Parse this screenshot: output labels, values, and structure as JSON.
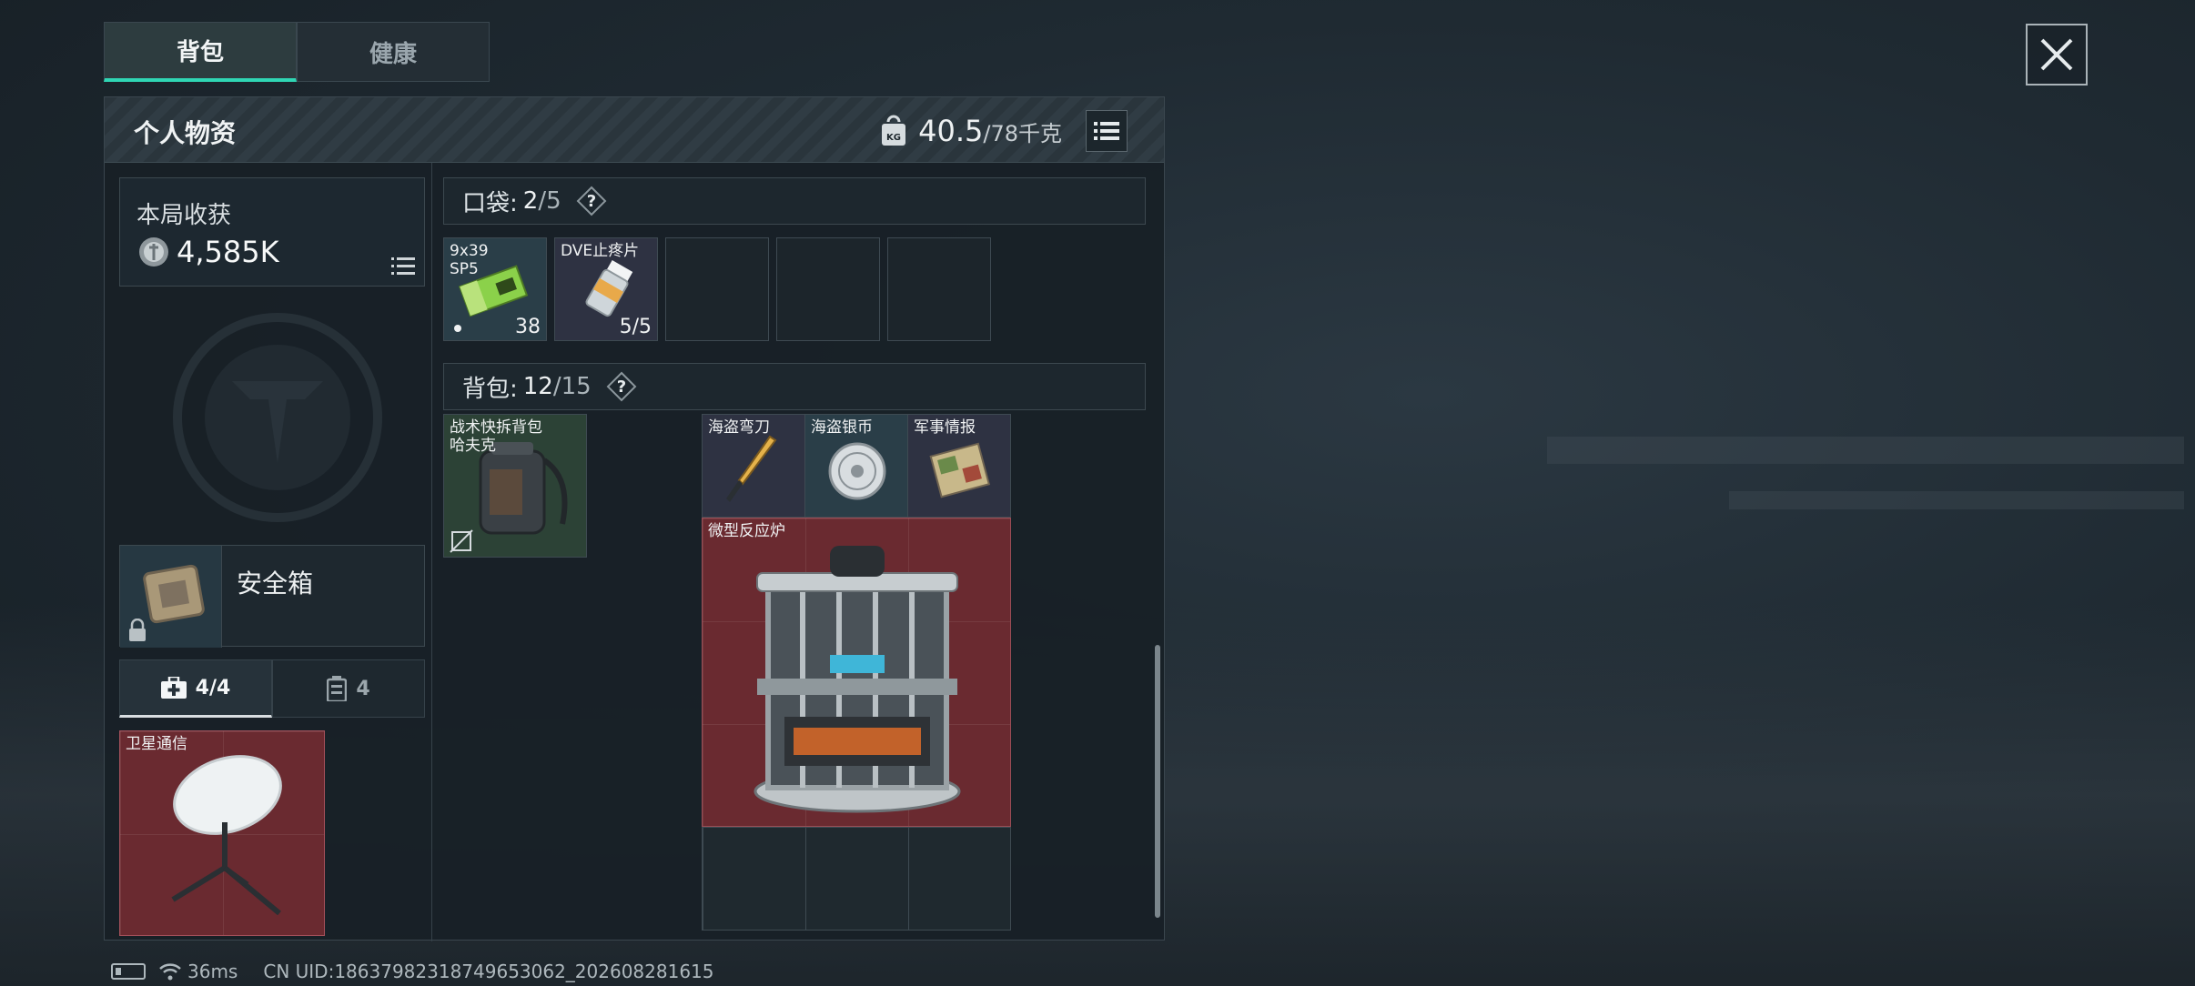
{
  "tabs": [
    {
      "label": "背包",
      "active": true
    },
    {
      "label": "健康",
      "active": false
    }
  ],
  "panel": {
    "title": "个人物资",
    "weight_current": "40.5",
    "weight_max": "/78千克",
    "weight_icon_text": "KG"
  },
  "haul": {
    "label": "本局收获",
    "value": "4,585K"
  },
  "safebox": {
    "label": "安全箱"
  },
  "sub_tabs": [
    {
      "label": "4/4",
      "icon": "medkit-icon",
      "active": true
    },
    {
      "label": "4",
      "icon": "canister-icon",
      "active": false
    }
  ],
  "special_item": {
    "name": "卫星通信",
    "rarity_color": "#6a2a30"
  },
  "pocket": {
    "label": "口袋:",
    "count": "2",
    "max": "/5",
    "items": [
      {
        "name": "9x39\nSP5",
        "qty": "38"
      },
      {
        "name": "DVE止疼片",
        "qty": "5/5"
      }
    ]
  },
  "backpack": {
    "label": "背包:",
    "count": "12",
    "max": "/15",
    "equipped": {
      "name": "战术快拆背包\n哈夫克"
    },
    "items": [
      {
        "name": "海盗弯刀"
      },
      {
        "name": "海盗银币"
      },
      {
        "name": "军事情报"
      },
      {
        "name": "微型反应炉"
      }
    ]
  },
  "status": {
    "ping": "36ms",
    "uid": "CN UID:18637982318749653062_202608281615"
  },
  "colors": {
    "accent": "#2fd6b4",
    "rarity_red": "#6a2a30",
    "rarity_blue": "#2a3e48",
    "rarity_green": "#2c4236"
  }
}
